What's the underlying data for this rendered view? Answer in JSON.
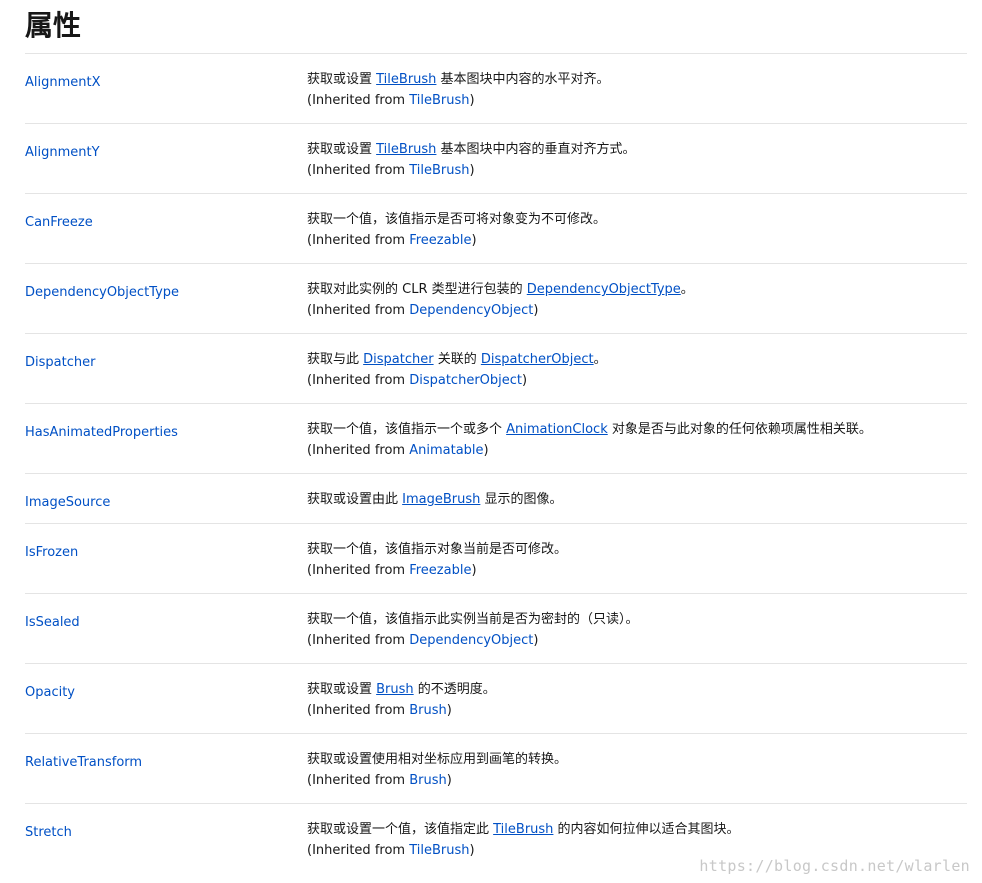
{
  "page_title": "属性",
  "inherited_prefix": "(Inherited from ",
  "inherited_suffix": ")",
  "rows": [
    {
      "name": "AlignmentX",
      "d1": "获取或设置 ",
      "l1": "TileBrush",
      "d2": " 基本图块中内容的水平对齐。",
      "l2": "",
      "d3": "",
      "inherited": "TileBrush"
    },
    {
      "name": "AlignmentY",
      "d1": "获取或设置 ",
      "l1": "TileBrush",
      "d2": " 基本图块中内容的垂直对齐方式。",
      "l2": "",
      "d3": "",
      "inherited": "TileBrush"
    },
    {
      "name": "CanFreeze",
      "d1": "获取一个值，该值指示是否可将对象变为不可修改。",
      "l1": "",
      "d2": "",
      "l2": "",
      "d3": "",
      "inherited": "Freezable"
    },
    {
      "name": "DependencyObjectType",
      "d1": "获取对此实例的 CLR 类型进行包装的 ",
      "l1": "DependencyObjectType",
      "d2": "。",
      "l2": "",
      "d3": "",
      "inherited": "DependencyObject"
    },
    {
      "name": "Dispatcher",
      "d1": "获取与此 ",
      "l1": "Dispatcher",
      "d2": " 关联的 ",
      "l2": "DispatcherObject",
      "d3": "。",
      "inherited": "DispatcherObject"
    },
    {
      "name": "HasAnimatedProperties",
      "d1": "获取一个值，该值指示一个或多个 ",
      "l1": "AnimationClock",
      "d2": " 对象是否与此对象的任何依赖项属性相关联。",
      "l2": "",
      "d3": "",
      "inherited": "Animatable"
    },
    {
      "name": "ImageSource",
      "d1": "获取或设置由此 ",
      "l1": "ImageBrush",
      "d2": " 显示的图像。",
      "l2": "",
      "d3": "",
      "inherited": ""
    },
    {
      "name": "IsFrozen",
      "d1": "获取一个值，该值指示对象当前是否可修改。",
      "l1": "",
      "d2": "",
      "l2": "",
      "d3": "",
      "inherited": "Freezable"
    },
    {
      "name": "IsSealed",
      "d1": "获取一个值，该值指示此实例当前是否为密封的（只读）。",
      "l1": "",
      "d2": "",
      "l2": "",
      "d3": "",
      "inherited": "DependencyObject"
    },
    {
      "name": "Opacity",
      "d1": "获取或设置 ",
      "l1": "Brush",
      "d2": " 的不透明度。",
      "l2": "",
      "d3": "",
      "inherited": "Brush"
    },
    {
      "name": "RelativeTransform",
      "d1": "获取或设置使用相对坐标应用到画笔的转换。",
      "l1": "",
      "d2": "",
      "l2": "",
      "d3": "",
      "inherited": "Brush"
    },
    {
      "name": "Stretch",
      "d1": "获取或设置一个值，该值指定此 ",
      "l1": "TileBrush",
      "d2": " 的内容如何拉伸以适合其图块。",
      "l2": "",
      "d3": "",
      "inherited": "TileBrush"
    }
  ],
  "watermark": "https://blog.csdn.net/wlarlen",
  "colors": {
    "link": "#0050c5",
    "text": "#171717",
    "divider": "#e4e4e4"
  }
}
